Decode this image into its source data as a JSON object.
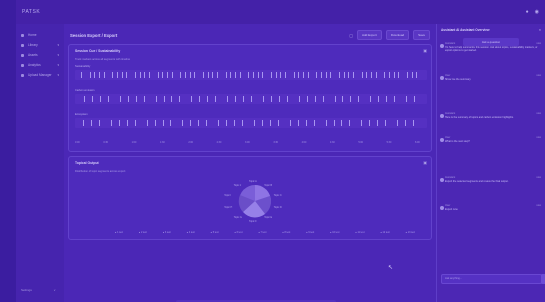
{
  "app": {
    "brand": "PATSK"
  },
  "topbar": {
    "icons": [
      "bell-icon",
      "user-icon"
    ]
  },
  "sidebar": {
    "items": [
      {
        "label": "Home"
      },
      {
        "label": "Library"
      },
      {
        "label": "Assets"
      },
      {
        "label": "Analytics"
      },
      {
        "label": "Upload Manager"
      }
    ],
    "footer_left": "Settings",
    "footer_right": "v"
  },
  "main": {
    "title": "Session Export / Export",
    "buttons": [
      "Add Export",
      "Download",
      "Save"
    ],
    "card1": {
      "title": "Session Cue / Sustainability",
      "subtitle": "Track markers across all segments with timeline",
      "lanes": [
        "Sustainability",
        "Carbon emission",
        "Ecosystem"
      ],
      "axis": [
        "0:00",
        "0:30",
        "1:00",
        "1:30",
        "2:00",
        "2:30",
        "3:00",
        "3:30",
        "4:00",
        "4:30",
        "5:00",
        "5:30",
        "6:00"
      ]
    },
    "card2": {
      "title": "Topical Output",
      "subtitle": "Distribution of topic segments across export",
      "pie_labels": [
        "Topic A",
        "Topic B",
        "Topic C",
        "Topic D",
        "Topic E",
        "Topic F",
        "Topic G",
        "Topic H",
        "Topic I",
        "Topic J"
      ],
      "dots": [
        "1 text",
        "2 text",
        "3 text",
        "4 text",
        "5 text",
        "6 text",
        "7 text",
        "8 text",
        "9 text",
        "10 text",
        "11 text",
        "12 text",
        "13 text"
      ]
    }
  },
  "bottombar": {
    "items": [
      "1",
      "2",
      "3",
      "4",
      "5",
      "6",
      "7",
      "8"
    ]
  },
  "chat": {
    "title": "Assistant AI Assistant Overview",
    "top_button": "Ask a question",
    "messages": [
      {
        "who": "Assistant",
        "time": "now",
        "body": "I'm here to help summarize this session. Ask about topics, sustainability markers, or export options to get started."
      },
      {
        "who": "User",
        "time": "now",
        "body": "Show me the summary."
      },
      {
        "who": "Assistant",
        "time": "now",
        "body": "Here is the summary of topics and carbon emission highlights."
      },
      {
        "who": "User",
        "time": "now",
        "body": "What is the next step?"
      },
      {
        "who": "Assistant",
        "time": "now",
        "body": "Export the selected segments and review the final output."
      },
      {
        "who": "User",
        "time": "now",
        "body": "Export now."
      }
    ],
    "input_placeholder": "Ask anything..."
  }
}
